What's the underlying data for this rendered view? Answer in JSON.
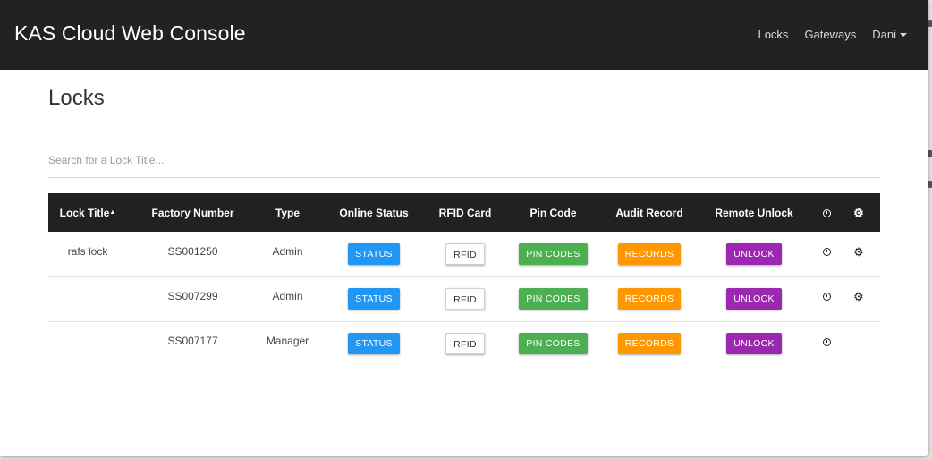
{
  "app": {
    "title": "KAS Cloud Web Console"
  },
  "nav": {
    "links": [
      {
        "label": "Locks"
      },
      {
        "label": "Gateways"
      },
      {
        "label": "Dani"
      }
    ]
  },
  "page": {
    "title": "Locks"
  },
  "search": {
    "placeholder": "Search for a Lock Title...",
    "value": ""
  },
  "table": {
    "headers": {
      "lock_title": "Lock Title",
      "factory_number": "Factory Number",
      "type": "Type",
      "online_status": "Online Status",
      "rfid_card": "RFID Card",
      "pin_code": "Pin Code",
      "audit_record": "Audit Record",
      "remote_unlock": "Remote Unlock",
      "history_icon": "clock-icon",
      "settings_icon": "gear-icon"
    },
    "sort": {
      "column": "lock_title",
      "direction": "ascending"
    },
    "buttons": {
      "status": "STATUS",
      "rfid": "RFID",
      "pin_codes": "PIN CODES",
      "records": "RECORDS",
      "unlock": "UNLOCK"
    },
    "rows": [
      {
        "lock_title": "rafs lock",
        "factory_number": "SS001250",
        "type": "Admin",
        "has_history": true,
        "has_settings": true
      },
      {
        "lock_title": "",
        "factory_number": "SS007299",
        "type": "Admin",
        "has_history": true,
        "has_settings": true
      },
      {
        "lock_title": "",
        "factory_number": "SS007177",
        "type": "Manager",
        "has_history": true,
        "has_settings": false
      }
    ]
  },
  "colors": {
    "navbar": "#222222",
    "status": "#2196f3",
    "pin_codes": "#4caf50",
    "records": "#ff9800",
    "unlock": "#9c27b0"
  }
}
